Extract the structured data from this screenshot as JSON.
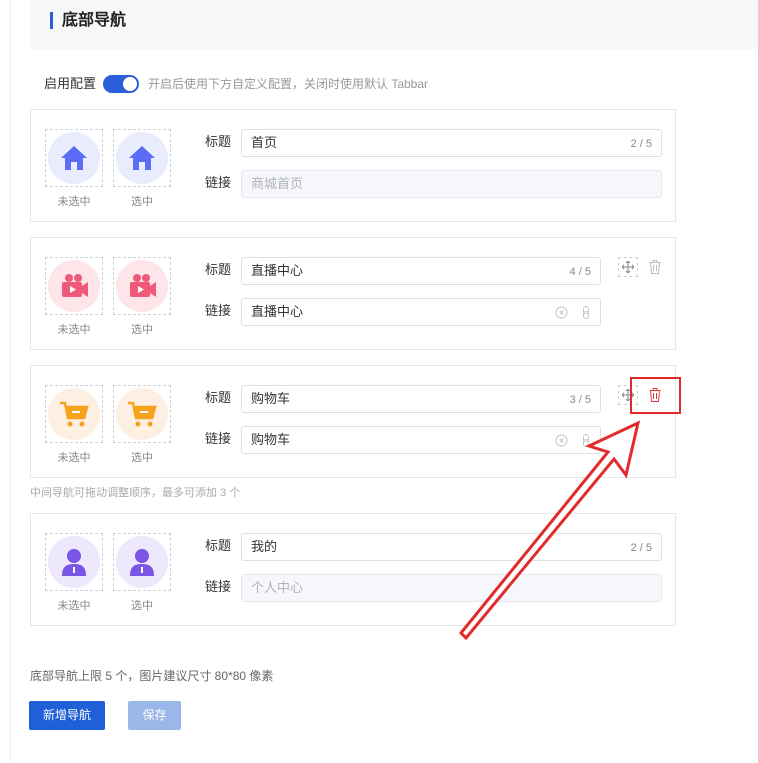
{
  "header": {
    "title": "底部导航"
  },
  "toggle": {
    "label": "启用配置",
    "on": true,
    "description": "开启后使用下方自定义配置，关闭时使用默认 Tabbar"
  },
  "labels": {
    "title": "标题",
    "link": "链接",
    "unselected": "未选中",
    "selected": "选中"
  },
  "nav_items": [
    {
      "title": "首页",
      "count": "2 / 5",
      "link": "",
      "link_placeholder": "商城首页",
      "icon": "home-icon",
      "color": "#5b6cf5",
      "bg": "#e9ecfd"
    },
    {
      "title": "直播中心",
      "count": "4 / 5",
      "link": "直播中心",
      "icon": "live-camera-icon",
      "color": "#f05a7a",
      "bg": "#fde5ea"
    },
    {
      "title": "购物车",
      "count": "3 / 5",
      "link": "购物车",
      "icon": "cart-icon",
      "color": "#f7a21b",
      "bg": "#fdf0e2"
    },
    {
      "title": "我的",
      "count": "2 / 5",
      "link": "",
      "link_placeholder": "个人中心",
      "icon": "user-icon",
      "color": "#7a55e6",
      "bg": "#ede8fb"
    }
  ],
  "hint": "中间导航可拖动调整顺序，最多可添加 3 个",
  "footer_note": "底部导航上限 5 个，图片建议尺寸 80*80 像素",
  "buttons": {
    "add": "新增导航",
    "save": "保存"
  },
  "colors": {
    "accent": "#1f5fd8",
    "highlight": "#e22b2b"
  }
}
